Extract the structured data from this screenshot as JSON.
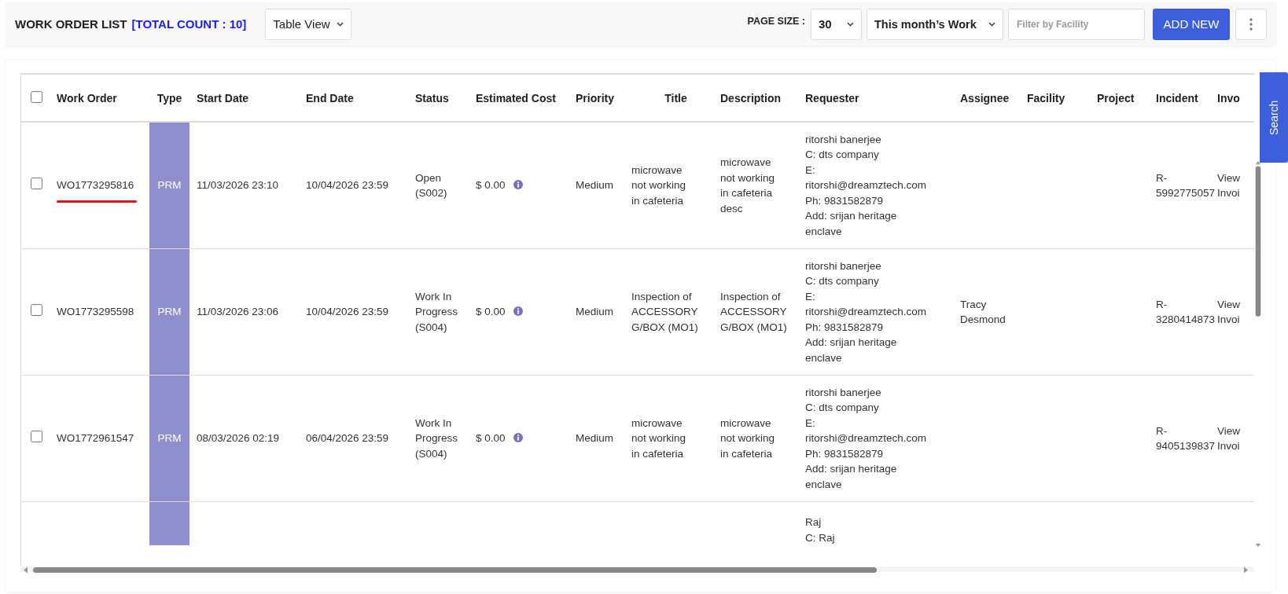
{
  "header": {
    "title": "WORK ORDER LIST",
    "total_count": "[TOTAL COUNT : 10]",
    "view_select": "Table View",
    "page_size_label": "PAGE SIZE :",
    "page_size": "30",
    "period_select": "This month’s Work",
    "facility_filter": {
      "placeholder": "Filter by Facility"
    },
    "add_button": "ADD NEW"
  },
  "search_tab": "Search",
  "table": {
    "select_all": {
      "checked": false
    },
    "columns": [
      "Work Order",
      "Type",
      "Start Date",
      "End Date",
      "Status",
      "Estimated Cost",
      "Priority",
      "Title",
      "Description",
      "Requester",
      "Assignee",
      "Facility",
      "Project",
      "Incident",
      "Invo"
    ],
    "rows": [
      {
        "checked": false,
        "work_order": "WO1773295816",
        "underlined": true,
        "type": "PRM",
        "start_date": "11/03/2026 23:10",
        "end_date": "10/04/2026 23:59",
        "status": "Open\n(S002)",
        "estimated_cost": "$ 0.00",
        "priority": "Medium",
        "title": "microwave\nnot working\nin cafeteria",
        "description": "microwave\nnot working\nin cafeteria\ndesc",
        "requester": "ritorshi banerjee\nC: dts company\nE:\nritorshi@dreamztech.com\nPh: 9831582879\nAdd: srijan heritage\nenclave",
        "incident": "R-\n5992775057",
        "invoice": "View\nInvoi"
      },
      {
        "checked": false,
        "work_order": "WO1773295598",
        "underlined": false,
        "type": "PRM",
        "start_date": "11/03/2026 23:06",
        "end_date": "10/04/2026 23:59",
        "status": "Work In\nProgress\n(S004)",
        "estimated_cost": "$ 0.00",
        "priority": "Medium",
        "title": "Inspection of\nACCESSORY\nG/BOX (MO1)",
        "description": "Inspection of\nACCESSORY\nG/BOX (MO1)",
        "requester": "ritorshi banerjee\nC: dts company\nE:\nritorshi@dreamztech.com\nPh: 9831582879\nAdd: srijan heritage\nenclave",
        "assignee": "Tracy\nDesmond",
        "incident": "R-\n3280414873",
        "invoice": "View\nInvoi"
      },
      {
        "checked": false,
        "work_order": "WO1772961547",
        "underlined": false,
        "type": "PRM",
        "start_date": "08/03/2026 02:19",
        "end_date": "06/04/2026 23:59",
        "status": "Work In\nProgress\n(S004)",
        "estimated_cost": "$ 0.00",
        "priority": "Medium",
        "title": "microwave\nnot working\nin cafeteria",
        "description": "microwave\nnot working\nin cafeteria",
        "requester": "ritorshi banerjee\nC: dts company\nE:\nritorshi@dreamztech.com\nPh: 9831582879\nAdd: srijan heritage\nenclave",
        "incident": "R-\n9405139837",
        "invoice": "View\nInvoi"
      },
      {
        "requester": "Raj\nC: Raj"
      }
    ]
  }
}
